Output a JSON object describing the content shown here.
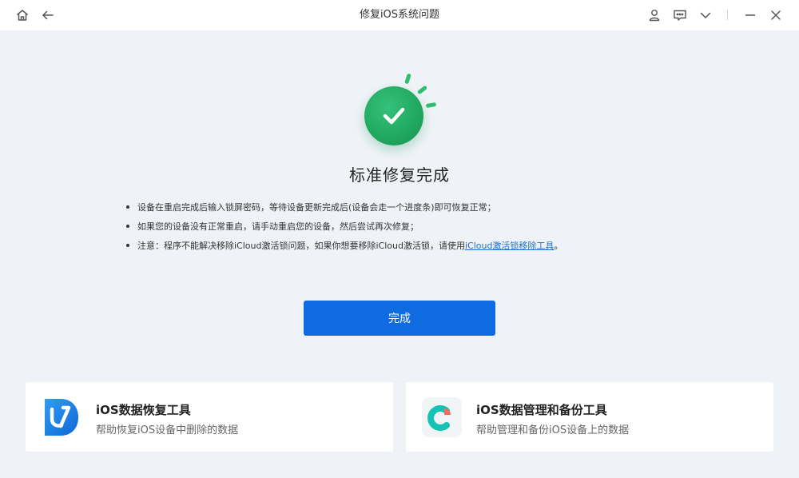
{
  "window": {
    "title": "修复iOS系统问题",
    "icons": [
      "home-icon",
      "back-arrow-icon",
      "user-icon",
      "feedback-icon",
      "chevron-down-icon",
      "minimize-icon",
      "close-icon"
    ]
  },
  "result": {
    "title": "标准修复完成",
    "status_icon": "check-circle-icon",
    "accent_color": "#20a75f"
  },
  "notes": {
    "item1": "设备在重启完成后输入锁屏密码，等待设备更新完成后(设备会走一个进度条)即可恢复正常；",
    "item2": "如果您的设备没有正常重启，请手动重启您的设备，然后尝试再次修复；",
    "item3_prefix": "注意：程序不能解决移除iCloud激活锁问题，如果你想要移除iCloud激活锁，请使用",
    "item3_link": "iCloud激活锁移除工具",
    "item3_suffix": "。"
  },
  "actions": {
    "done_label": "完成",
    "button_color": "#0f6ce0"
  },
  "cards": [
    {
      "title": "iOS数据恢复工具",
      "subtitle": "帮助恢复iOS设备中删除的数据",
      "icon": "data-recovery-app-icon"
    },
    {
      "title": "iOS数据管理和备份工具",
      "subtitle": "帮助管理和备份iOS设备上的数据",
      "icon": "data-backup-app-icon"
    }
  ]
}
